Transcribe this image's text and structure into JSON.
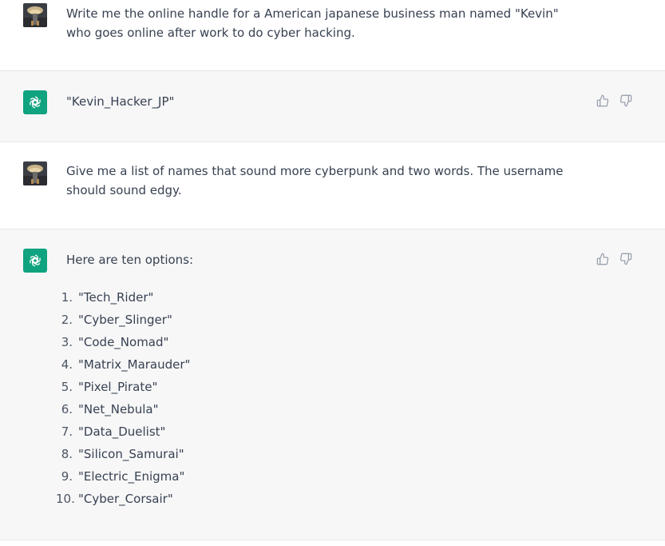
{
  "conversation": {
    "messages": [
      {
        "role": "user",
        "text": "Write me the online handle for a American japanese business man named \"Kevin\" who goes online after work to do cyber hacking."
      },
      {
        "role": "assistant",
        "text": "\"Kevin_Hacker_JP\""
      },
      {
        "role": "user",
        "text": "Give me a list of names that sound more cyberpunk and two words. The username should sound edgy."
      },
      {
        "role": "assistant",
        "intro": "Here are ten options:",
        "list": [
          {
            "num": "1.",
            "text": "\"Tech_Rider\""
          },
          {
            "num": "2.",
            "text": "\"Cyber_Slinger\""
          },
          {
            "num": "3.",
            "text": "\"Code_Nomad\""
          },
          {
            "num": "4.",
            "text": "\"Matrix_Marauder\""
          },
          {
            "num": "5.",
            "text": "\"Pixel_Pirate\""
          },
          {
            "num": "6.",
            "text": "\"Net_Nebula\""
          },
          {
            "num": "7.",
            "text": "\"Data_Duelist\""
          },
          {
            "num": "8.",
            "text": "\"Silicon_Samurai\""
          },
          {
            "num": "9.",
            "text": "\"Electric_Enigma\""
          },
          {
            "num": "10.",
            "text": "\"Cyber_Corsair\""
          }
        ]
      }
    ]
  },
  "icons": {
    "assistant_avatar": "openai-logo-icon",
    "user_avatar": "user-avatar-image",
    "thumbs_up": "thumbs-up-icon",
    "thumbs_down": "thumbs-down-icon"
  },
  "colors": {
    "assistant_bg": "#f7f7f8",
    "user_bg": "#ffffff",
    "accent": "#10a37f",
    "text": "#374151",
    "icon": "#9ca3af"
  }
}
